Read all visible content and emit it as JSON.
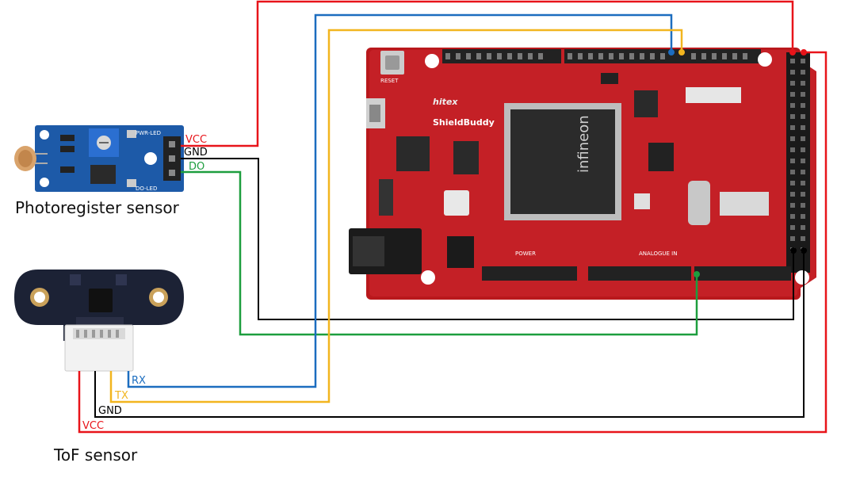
{
  "captions": {
    "photo_sensor": "Photoregister sensor",
    "tof_sensor": "ToF sensor"
  },
  "photo_pins": {
    "vcc": "VCC",
    "gnd": "GND",
    "do": "DO",
    "pwr_led": "PWR-LED",
    "do_led": "DO-LED"
  },
  "tof_pins": {
    "rx": "RX",
    "tx": "TX",
    "gnd": "GND",
    "vcc": "VCC"
  },
  "board": {
    "reset": "RESET",
    "brand": "hitex",
    "name": "ShieldBuddy",
    "chip": "infineon",
    "power": "POWER",
    "analog": "ANALOGUE IN"
  },
  "wire_colors": {
    "vcc": "#e8141a",
    "gnd": "#000000",
    "data": "#1d9e3e",
    "rx": "#1c6dbf",
    "tx": "#f2b51f"
  },
  "icons": [
    "photoresistor-icon",
    "potentiometer-icon",
    "tof-sensor-icon",
    "microcontroller-chip-icon"
  ]
}
